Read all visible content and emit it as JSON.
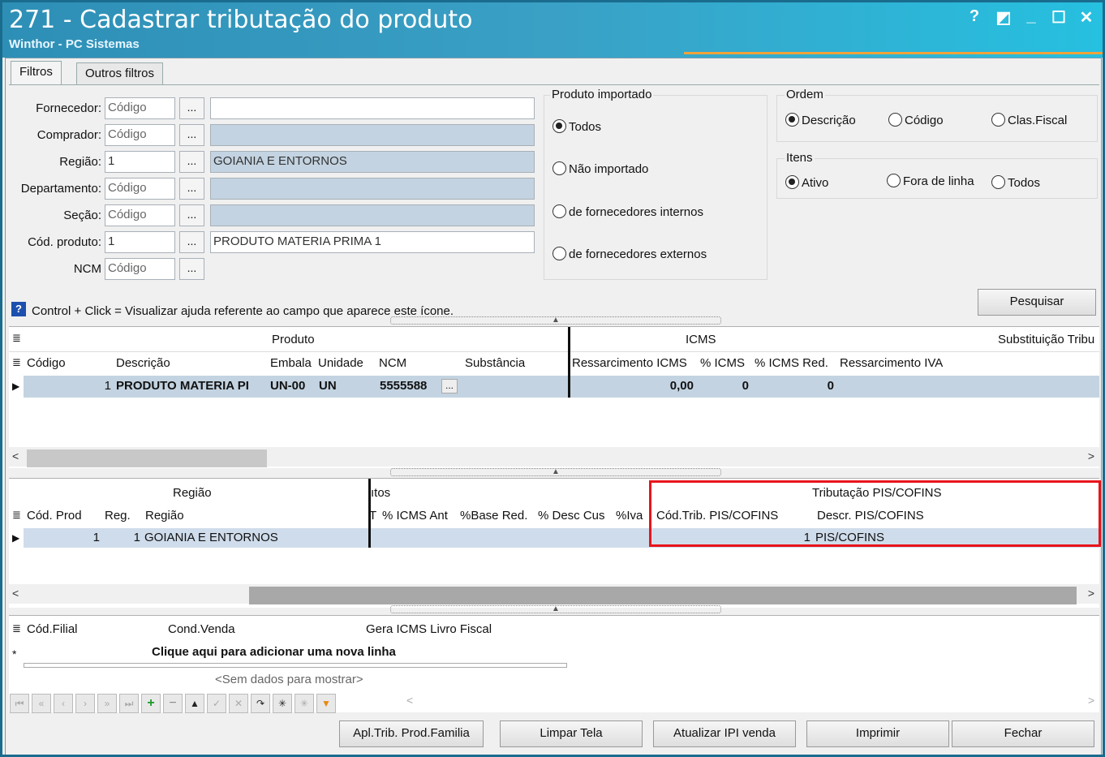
{
  "window": {
    "title": "271 - Cadastrar tributação do produto",
    "subtitle": "Winthor - PC Sistemas",
    "controls": [
      "?",
      "◩",
      "_",
      "☐",
      "✕"
    ]
  },
  "tabs": [
    "Filtros",
    "Outros filtros"
  ],
  "filters": {
    "fornecedor": {
      "label": "Fornecedor:",
      "code": "Código",
      "desc": ""
    },
    "comprador": {
      "label": "Comprador:",
      "code": "Código",
      "desc": ""
    },
    "regiao": {
      "label": "Região:",
      "code": "1",
      "desc": "GOIANIA E ENTORNOS"
    },
    "departamento": {
      "label": "Departamento:",
      "code": "Código",
      "desc": ""
    },
    "secao": {
      "label": "Seção:",
      "code": "Código",
      "desc": ""
    },
    "cod_produto": {
      "label": "Cód. produto:",
      "code": "1",
      "desc": "PRODUTO MATERIA PRIMA 1"
    },
    "ncm": {
      "label": "NCM",
      "code": "Código"
    },
    "dots": "..."
  },
  "produto_importado": {
    "title": "Produto importado",
    "options": [
      "Todos",
      "Não importado",
      "de fornecedores internos",
      "de fornecedores externos"
    ],
    "selected": 0
  },
  "ordem": {
    "title": "Ordem",
    "options": [
      "Descrição",
      "Código",
      "Clas.Fiscal"
    ],
    "selected": 0
  },
  "itens": {
    "title": "Itens",
    "options": [
      "Ativo",
      "Fora de linha",
      "Todos"
    ],
    "selected": 0
  },
  "help_text": "Control + Click = Visualizar ajuda referente ao campo que aparece este ícone.",
  "pesquisar": "Pesquisar",
  "grid1": {
    "bands": {
      "produto": "Produto",
      "icms": "ICMS",
      "subst": "Substituição Tribu"
    },
    "cols": [
      "Código",
      "Descrição",
      "Embala",
      "Unidade",
      "NCM",
      "Substância",
      "Ressarcimento ICMS",
      "% ICMS",
      "% ICMS Red.",
      "Ressarcimento IVA"
    ],
    "row": {
      "codigo": "1",
      "descricao": "PRODUTO MATERIA PI",
      "embala": "UN-00",
      "unidade": "UN",
      "ncm": "5555588",
      "ress": "0,00",
      "icms": "0",
      "icmsred": "0"
    }
  },
  "grid2": {
    "bands": {
      "regiao": "Região",
      "utos": "ıtos",
      "pis": "Tributação PIS/COFINS"
    },
    "cols": [
      "Cód. Prod",
      "Reg.",
      "Região",
      "T",
      "% ICMS Ant",
      "%Base Red.",
      "% Desc Cus",
      "%Iva",
      "Cód.Trib. PIS/COFINS",
      "Descr. PIS/COFINS"
    ],
    "row": {
      "codprod": "1",
      "reg": "1",
      "regiao": "GOIANIA E ENTORNOS",
      "codtrib": "1",
      "descr": "PIS/COFINS"
    }
  },
  "grid3": {
    "cols": [
      "Cód.Filial",
      "Cond.Venda",
      "Gera ICMS Livro Fiscal"
    ],
    "add_row": "Clique aqui para adicionar uma nova linha",
    "empty": "<Sem dados para mostrar>"
  },
  "buttons": [
    "Apl.Trib. Prod.Familia",
    "Limpar Tela",
    "Atualizar IPI venda",
    "Imprimir",
    "Fechar"
  ],
  "highlight_color": "#e8141b"
}
